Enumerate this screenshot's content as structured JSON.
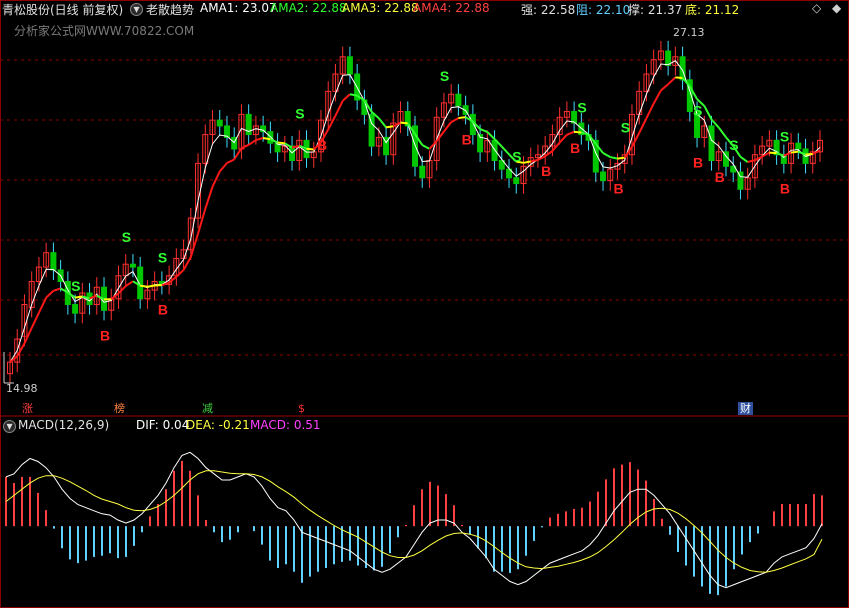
{
  "header": {
    "stock_name": "青松股份(日线 前复权)",
    "indicator_name": "老散趋势",
    "ama1_label": "AMA1: 23.07",
    "ama2_label": "AMA2: 22.88",
    "ama3_label": "AMA3: 22.88",
    "ama4_label": "AMA4: 22.88",
    "qiang_label": "强: 22.58",
    "zu_label": "阻: 22.10",
    "cheng_label": "撑: 21.37",
    "di_label": "底: 21.12",
    "nav_left": "◇",
    "nav_right": "◆"
  },
  "watermark": "分析家公式网WWW.70822.COM",
  "price_high_label": "27.13",
  "price_low_label": "14.98",
  "events": [
    {
      "label": "涨",
      "color": "#ff4040"
    },
    {
      "label": "榜",
      "color": "#ff8040"
    },
    {
      "label": "减",
      "color": "#40d040"
    },
    {
      "label": "$",
      "color": "#ff3030"
    },
    {
      "label": "财",
      "color": "#ffffff"
    }
  ],
  "macd_header": {
    "title": "MACD(12,26,9)",
    "dif_label": "DIF: 0.04",
    "dea_label": "DEA: -0.21",
    "macd_label": "MACD: 0.51"
  },
  "colors": {
    "up": "#ff3030",
    "down": "#00c800",
    "ama1": "#ffffff",
    "trend_red": "#ff1818",
    "trend_green": "#30ff30",
    "trend_yellow": "#ffff00",
    "grid": "#8b0000",
    "dif": "#ffffff",
    "dea": "#ffff40",
    "macd_pos": "#ff4040",
    "macd_neg": "#60d0ff",
    "signal_b": "#ff2020",
    "signal_s": "#30ff30"
  },
  "chart_data": {
    "type": "candlestick",
    "price_range": [
      14.98,
      27.13
    ],
    "close": [
      15.6,
      16.4,
      17.6,
      18.4,
      18.9,
      19.4,
      18.8,
      18.4,
      17.6,
      17.3,
      18.0,
      17.6,
      18.2,
      17.4,
      17.8,
      18.6,
      19.0,
      18.9,
      17.8,
      18.1,
      18.4,
      18.3,
      18.6,
      19.2,
      19.5,
      20.6,
      22.5,
      23.5,
      24.0,
      23.8,
      23.4,
      23.0,
      24.2,
      23.5,
      23.8,
      23.6,
      23.2,
      22.9,
      23.1,
      22.6,
      23.3,
      22.7,
      22.9,
      24.0,
      25.0,
      25.6,
      26.2,
      25.6,
      24.7,
      24.2,
      23.1,
      23.4,
      22.8,
      23.9,
      24.3,
      23.8,
      22.4,
      22.0,
      22.6,
      24.1,
      24.6,
      24.9,
      24.5,
      24.2,
      23.5,
      22.9,
      23.3,
      22.6,
      22.3,
      22.0,
      21.8,
      22.4,
      22.7,
      22.8,
      23.1,
      23.5,
      24.1,
      24.3,
      23.9,
      23.5,
      23.3,
      22.2,
      21.9,
      22.3,
      22.5,
      22.8,
      24.2,
      25.0,
      25.6,
      26.1,
      26.4,
      25.9,
      26.2,
      25.4,
      24.3,
      23.4,
      23.8,
      22.6,
      22.9,
      22.4,
      22.2,
      21.6,
      22.0,
      22.8,
      23.1,
      23.3,
      22.8,
      22.5,
      23.2,
      23.0,
      22.5,
      22.9,
      23.3
    ],
    "open": [
      15.2,
      15.6,
      16.5,
      17.5,
      18.4,
      18.9,
      19.4,
      18.8,
      18.4,
      17.6,
      17.3,
      18.0,
      17.6,
      18.2,
      17.4,
      17.8,
      18.6,
      19.0,
      18.9,
      17.8,
      18.1,
      18.4,
      18.3,
      18.6,
      19.2,
      19.5,
      20.6,
      22.5,
      23.5,
      24.0,
      23.8,
      23.4,
      23.0,
      24.2,
      23.5,
      23.8,
      23.6,
      23.2,
      22.9,
      23.1,
      22.6,
      23.3,
      22.7,
      22.9,
      24.0,
      25.0,
      25.6,
      26.2,
      25.6,
      24.7,
      24.2,
      23.1,
      23.4,
      22.8,
      23.9,
      24.3,
      23.8,
      22.4,
      22.0,
      22.6,
      24.1,
      24.6,
      24.9,
      24.5,
      24.2,
      23.5,
      22.9,
      23.3,
      22.6,
      22.3,
      22.0,
      21.8,
      22.4,
      22.7,
      22.8,
      23.1,
      23.5,
      24.1,
      24.3,
      23.9,
      23.5,
      23.3,
      22.2,
      21.9,
      22.3,
      22.5,
      22.8,
      24.2,
      25.0,
      25.6,
      26.1,
      26.4,
      25.9,
      26.2,
      25.4,
      24.3,
      23.4,
      23.8,
      22.6,
      22.9,
      22.4,
      22.2,
      21.6,
      22.0,
      22.8,
      23.1,
      23.3,
      22.8,
      22.5,
      23.2,
      23.0,
      22.5,
      22.9
    ],
    "buy_signals": [
      13,
      21,
      43,
      63,
      74,
      78,
      84,
      95,
      98,
      107
    ],
    "sell_signals": [
      9,
      16,
      21,
      40,
      60,
      70,
      79,
      85,
      95,
      100,
      107
    ],
    "macd": {
      "dif": [
        0.8,
        0.85,
        1.0,
        1.1,
        1.05,
        0.95,
        0.8,
        0.6,
        0.45,
        0.35,
        0.3,
        0.25,
        0.2,
        0.18,
        0.1,
        0.05,
        0.1,
        0.2,
        0.35,
        0.5,
        0.7,
        0.95,
        1.15,
        1.2,
        1.1,
        0.95,
        0.85,
        0.75,
        0.75,
        0.8,
        0.85,
        0.8,
        0.65,
        0.45,
        0.3,
        0.25,
        0.1,
        -0.1,
        -0.15,
        -0.2,
        -0.25,
        -0.3,
        -0.35,
        -0.4,
        -0.5,
        -0.6,
        -0.7,
        -0.75,
        -0.7,
        -0.6,
        -0.5,
        -0.3,
        -0.1,
        0.05,
        0.1,
        0.1,
        0.05,
        -0.1,
        -0.2,
        -0.35,
        -0.5,
        -0.7,
        -0.8,
        -0.9,
        -0.95,
        -0.9,
        -0.8,
        -0.7,
        -0.6,
        -0.55,
        -0.5,
        -0.45,
        -0.4,
        -0.3,
        -0.15,
        0.05,
        0.25,
        0.4,
        0.55,
        0.6,
        0.6,
        0.5,
        0.35,
        0.2,
        0.0,
        -0.2,
        -0.4,
        -0.6,
        -0.8,
        -0.95,
        -1.0,
        -0.95,
        -0.9,
        -0.85,
        -0.8,
        -0.75,
        -0.6,
        -0.5,
        -0.45,
        -0.4,
        -0.35,
        -0.2,
        0.04
      ],
      "dea": [
        0.4,
        0.5,
        0.6,
        0.7,
        0.78,
        0.82,
        0.82,
        0.78,
        0.72,
        0.65,
        0.58,
        0.5,
        0.44,
        0.4,
        0.36,
        0.3,
        0.26,
        0.25,
        0.27,
        0.32,
        0.4,
        0.5,
        0.62,
        0.75,
        0.85,
        0.9,
        0.9,
        0.88,
        0.86,
        0.85,
        0.85,
        0.84,
        0.8,
        0.73,
        0.64,
        0.56,
        0.47,
        0.36,
        0.26,
        0.17,
        0.09,
        0.01,
        -0.06,
        -0.12,
        -0.18,
        -0.26,
        -0.34,
        -0.42,
        -0.48,
        -0.51,
        -0.51,
        -0.47,
        -0.4,
        -0.31,
        -0.23,
        -0.16,
        -0.12,
        -0.11,
        -0.13,
        -0.17,
        -0.24,
        -0.33,
        -0.43,
        -0.52,
        -0.6,
        -0.66,
        -0.68,
        -0.69,
        -0.67,
        -0.65,
        -0.62,
        -0.59,
        -0.55,
        -0.5,
        -0.43,
        -0.33,
        -0.22,
        -0.1,
        0.03,
        0.14,
        0.23,
        0.28,
        0.29,
        0.27,
        0.21,
        0.12,
        0.01,
        -0.11,
        -0.25,
        -0.39,
        -0.51,
        -0.6,
        -0.67,
        -0.72,
        -0.74,
        -0.75,
        -0.72,
        -0.68,
        -0.63,
        -0.58,
        -0.53,
        -0.46,
        -0.21
      ],
      "range": [
        -1.2,
        1.4
      ]
    }
  }
}
